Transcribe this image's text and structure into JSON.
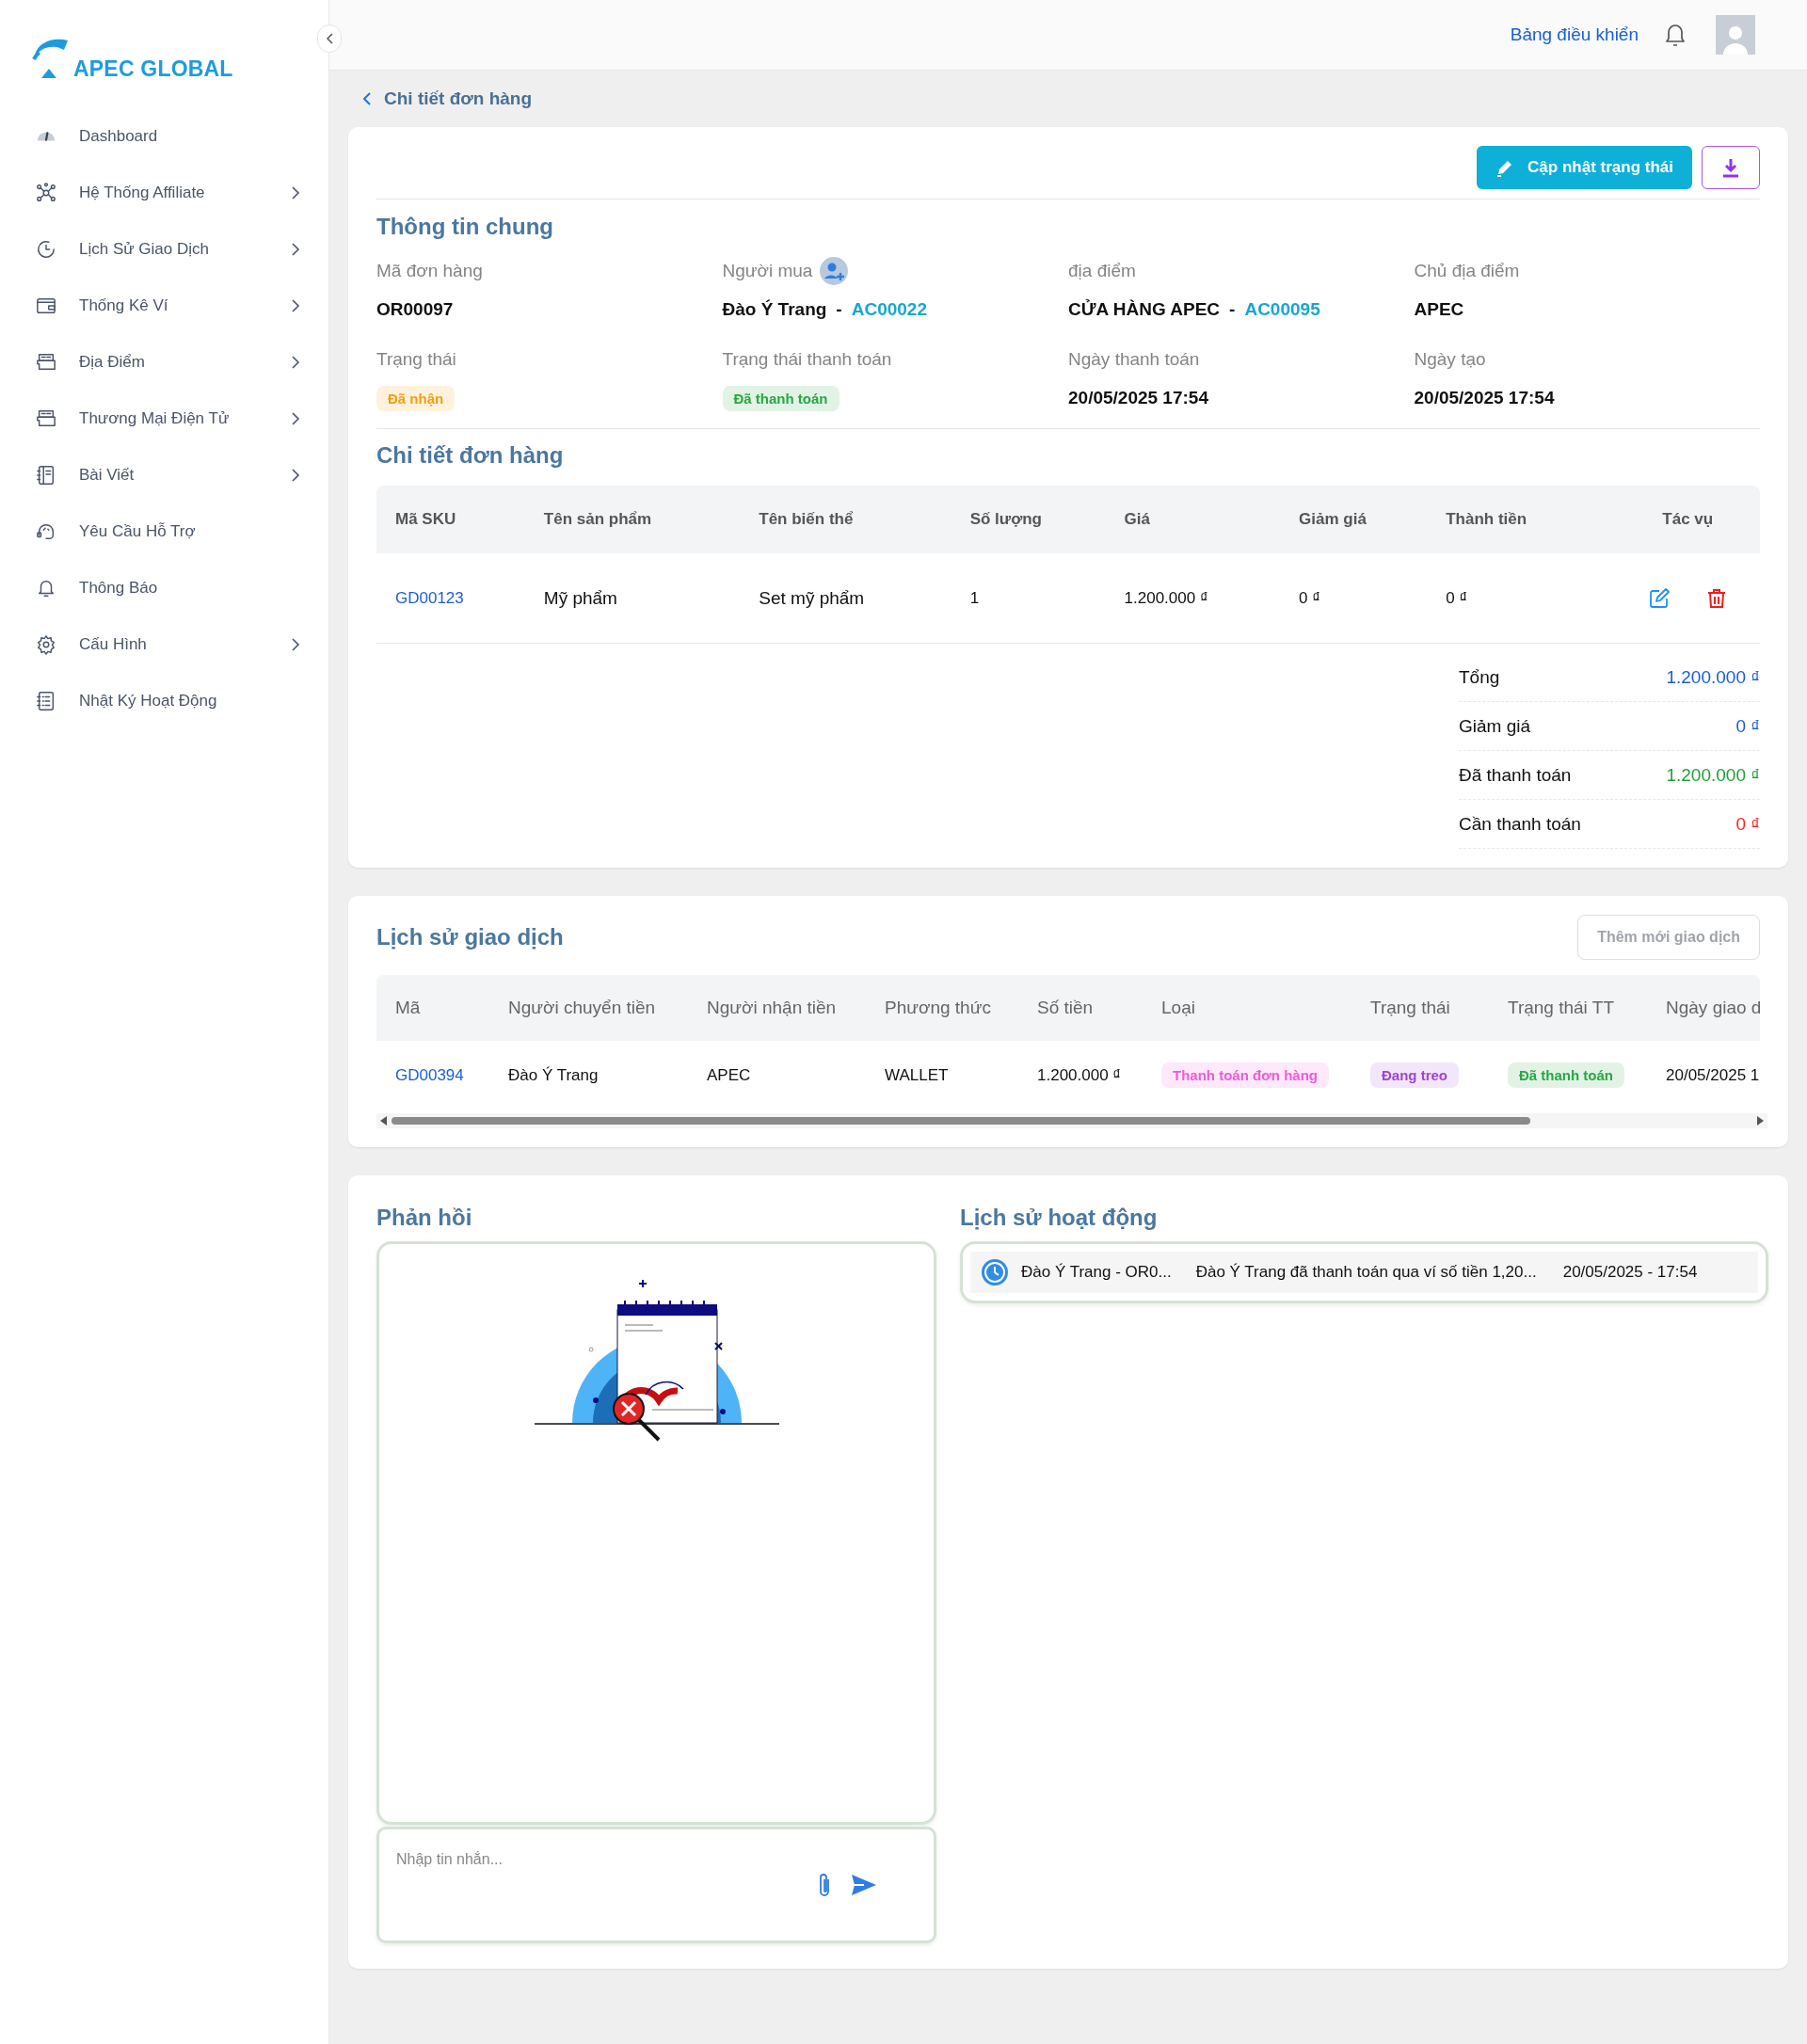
{
  "sidebar": {
    "logo": "APEC GLOBAL",
    "items": [
      {
        "label": "Dashboard",
        "expandable": false
      },
      {
        "label": "Hệ Thống Affiliate",
        "expandable": true
      },
      {
        "label": "Lịch Sử Giao Dịch",
        "expandable": true
      },
      {
        "label": "Thống Kê Ví",
        "expandable": true
      },
      {
        "label": "Địa Điểm",
        "expandable": true
      },
      {
        "label": "Thương Mại Điện Tử",
        "expandable": true
      },
      {
        "label": "Bài Viết",
        "expandable": true
      },
      {
        "label": "Yêu Cầu Hỗ Trợ",
        "expandable": false
      },
      {
        "label": "Thông Báo",
        "expandable": false
      },
      {
        "label": "Cấu Hình",
        "expandable": true
      },
      {
        "label": "Nhật Ký Hoạt Động",
        "expandable": false
      }
    ]
  },
  "header": {
    "link": "Bảng điều khiển"
  },
  "breadcrumb": "Chi tiết đơn hàng",
  "general_info": {
    "update_button": "Cập nhật trạng thái",
    "title": "Thông tin chung",
    "fields": [
      {
        "kind": "text",
        "label": "Mã đơn hàng",
        "value": "OR00097"
      },
      {
        "kind": "person",
        "label": "Người mua",
        "value": "Đào Ý Trang",
        "separator": "-",
        "code": "AC00022"
      },
      {
        "kind": "place",
        "label": "địa điểm",
        "value": "CỬA HÀNG APEC",
        "separator": "-",
        "code": "AC00095"
      },
      {
        "kind": "text",
        "label": "Chủ địa điểm",
        "value": "APEC"
      },
      {
        "kind": "badge",
        "label": "Trạng thái",
        "value": "Đã nhận",
        "color": "#f59e0b"
      },
      {
        "kind": "badge",
        "label": "Trạng thái thanh toán",
        "value": "Đã thanh toán",
        "color": "#28a745"
      },
      {
        "kind": "text",
        "label": "Ngày thanh toán",
        "value": "20/05/2025 17:54"
      },
      {
        "kind": "text",
        "label": "Ngày tạo",
        "value": "20/05/2025 17:54"
      }
    ]
  },
  "order_details": {
    "title": "Chi tiết đơn hàng",
    "columns": [
      "Mã SKU",
      "Tên sản phẩm",
      "Tên biến thể",
      "Số lượng",
      "Giá",
      "Giảm giá",
      "Thành tiền",
      "Tác vụ"
    ],
    "rows": [
      {
        "sku": "GD00123",
        "product": "Mỹ phẩm",
        "variant": "Set mỹ phẩm",
        "quantity": "1",
        "price": "1.200.000 ₫",
        "discount": "0 ₫",
        "total": "0 ₫"
      }
    ],
    "summary": [
      {
        "label": "Tổng",
        "value": "1.200.000 ₫",
        "color": "#1a5fd6"
      },
      {
        "label": "Giảm giá",
        "value": "0 ₫",
        "color": "#1a5fd6"
      },
      {
        "label": "Đã thanh toán",
        "value": "1.200.000 ₫",
        "color": "#22a03a"
      },
      {
        "label": "Cần thanh toán",
        "value": "0 ₫",
        "color": "#ff2323"
      }
    ]
  },
  "transactions": {
    "title": "Lịch sử giao dịch",
    "add_button": {
      "label": "Thêm mới giao dịch",
      "disabled": true
    },
    "columns": [
      "Mã",
      "Người chuyển tiền",
      "Người nhận tiền",
      "Phương thức",
      "Số tiền",
      "Loại",
      "Trạng thái",
      "Trạng thái TT",
      "Ngày giao d"
    ],
    "rows": [
      {
        "cells": [
          {
            "kind": "link",
            "text": "GD00394"
          },
          {
            "kind": "text",
            "text": "Đào Ý Trang"
          },
          {
            "kind": "text",
            "text": "APEC"
          },
          {
            "kind": "text",
            "text": "WALLET"
          },
          {
            "kind": "text",
            "text": "1.200.000 ₫"
          },
          {
            "kind": "badge",
            "text": "Thanh toán đơn hàng",
            "color": "#f05ad8"
          },
          {
            "kind": "badge",
            "text": "Đang treo",
            "color": "#a142d6"
          },
          {
            "kind": "badge",
            "text": "Đã thanh toán",
            "color": "#28a745"
          },
          {
            "kind": "text",
            "text": "20/05/2025 1"
          }
        ]
      }
    ]
  },
  "feedback": {
    "title": "Phản hồi",
    "placeholder": "Nhập tin nhắn..."
  },
  "activity": {
    "title": "Lịch sử hoạt động",
    "items": [
      {
        "subject": "Đào Ý Trang - OR0...",
        "message": "Đào Ý Trang đã thanh toán qua ví số tiền 1,20...",
        "time": "20/05/2025 - 17:54"
      }
    ]
  }
}
